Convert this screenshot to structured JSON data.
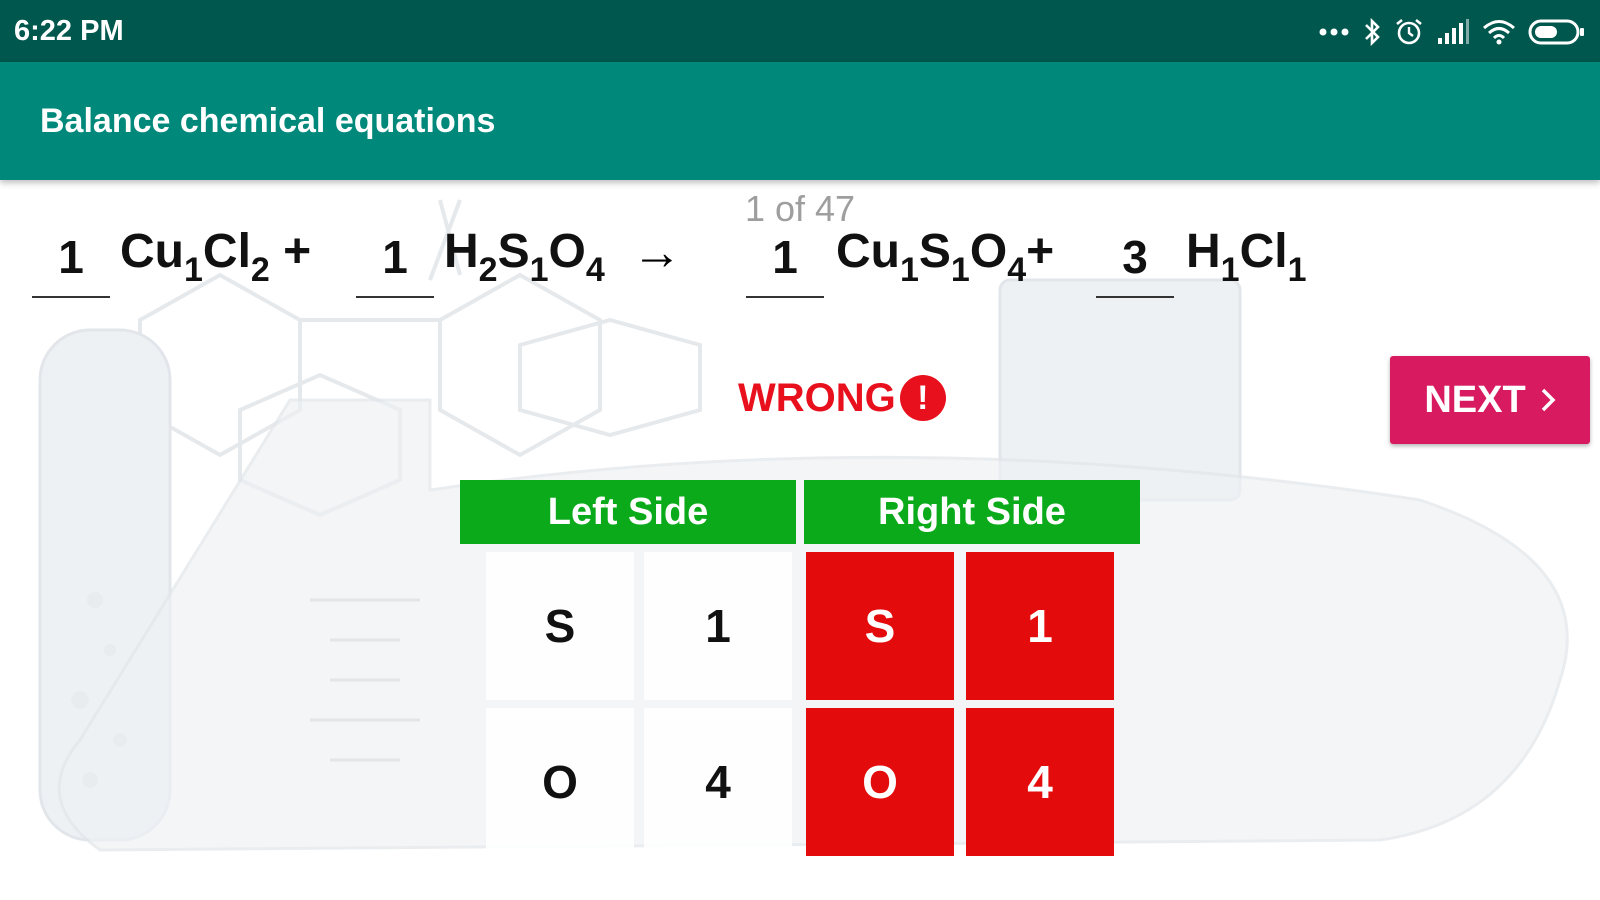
{
  "status_bar": {
    "time": "6:22 PM",
    "icons": [
      "more-dots-icon",
      "bluetooth-icon",
      "alarm-icon",
      "signal-icon",
      "wifi-icon",
      "battery-icon"
    ]
  },
  "app_bar": {
    "title": "Balance chemical equations"
  },
  "counter": "1 of 47",
  "equation": {
    "reactants": [
      {
        "coefficient": "1",
        "formula": [
          {
            "el": "Cu",
            "n": "1"
          },
          {
            "el": "Cl",
            "n": "2"
          }
        ],
        "suffix": " +"
      },
      {
        "coefficient": "1",
        "formula": [
          {
            "el": "H",
            "n": "2"
          },
          {
            "el": "S",
            "n": "1"
          },
          {
            "el": "O",
            "n": "4"
          }
        ],
        "suffix": ""
      }
    ],
    "arrow": "→",
    "products": [
      {
        "coefficient": "1",
        "formula": [
          {
            "el": "Cu",
            "n": "1"
          },
          {
            "el": "S",
            "n": "1"
          },
          {
            "el": "O",
            "n": "4"
          }
        ],
        "suffix": "+"
      },
      {
        "coefficient": "3",
        "formula": [
          {
            "el": "H",
            "n": "1"
          },
          {
            "el": "Cl",
            "n": "1"
          }
        ],
        "suffix": ""
      }
    ]
  },
  "result": {
    "label": "WRONG",
    "icon": "exclamation-circle-icon",
    "color": "#e8101d"
  },
  "next_button": {
    "label": "NEXT",
    "icon": "chevron-right-icon",
    "color": "#d81b60"
  },
  "table": {
    "left_header": "Left Side",
    "right_header": "Right Side",
    "header_color": "#0aaa1a",
    "mismatch_color": "#e30b0b",
    "rows": [
      {
        "left_element": "S",
        "left_count": "1",
        "right_element": "S",
        "right_count": "1"
      },
      {
        "left_element": "O",
        "left_count": "4",
        "right_element": "O",
        "right_count": "4"
      }
    ]
  }
}
